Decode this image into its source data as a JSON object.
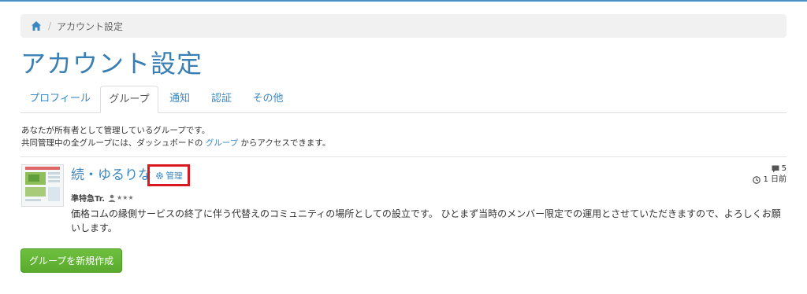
{
  "breadcrumb": {
    "home_icon": "home-icon",
    "current": "アカウント設定"
  },
  "page": {
    "title": "アカウント設定"
  },
  "tabs": [
    {
      "label": "プロフィール",
      "active": false
    },
    {
      "label": "グループ",
      "active": true
    },
    {
      "label": "通知",
      "active": false
    },
    {
      "label": "認証",
      "active": false
    },
    {
      "label": "その他",
      "active": false
    }
  ],
  "intro": {
    "line1": "あなたが所有者として管理しているグループです。",
    "line2_prefix": "共同管理中の全グループには、ダッシュボードの ",
    "line2_link": "グループ",
    "line2_suffix": " からアクセスできます。"
  },
  "group": {
    "title": "続・ゆるりな",
    "manage_label": "管理",
    "owner": "準特急Tr.",
    "rating_stars": "★★★",
    "description": "価格コムの縁側サービスの終了に伴う代替えのコミュニティの場所としての設立です。 ひとまず当時のメンバー限定での運用とさせていただきますので、よろしくお願いします。",
    "comment_count": "5",
    "age": "1 日前"
  },
  "actions": {
    "create_group": "グループを新規作成"
  },
  "colors": {
    "accent": "#3a87c4",
    "title": "#3a7fb4",
    "button": "#5cae32",
    "highlight": "#d9181f"
  }
}
